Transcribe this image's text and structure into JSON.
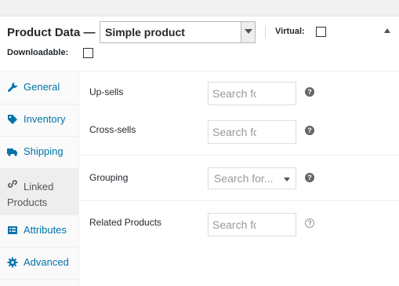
{
  "header": {
    "title": "Product Data",
    "dash": "—",
    "product_type": "Simple product",
    "virtual_label": "Virtual:",
    "downloadable_label": "Downloadable:"
  },
  "tabs": [
    {
      "label": "General",
      "icon": "wrench-icon"
    },
    {
      "label": "Inventory",
      "icon": "tag-icon"
    },
    {
      "label": "Shipping",
      "icon": "truck-icon"
    },
    {
      "label": "Linked Products",
      "icon": "link-icon"
    },
    {
      "label": "Attributes",
      "icon": "list-icon"
    },
    {
      "label": "Advanced",
      "icon": "gear-icon"
    }
  ],
  "panel": {
    "upsells": {
      "label": "Up-sells",
      "placeholder": "Search fo"
    },
    "crosssells": {
      "label": "Cross-sells",
      "placeholder": "Search fo"
    },
    "grouping": {
      "label": "Grouping",
      "placeholder": "Search for..."
    },
    "related": {
      "label": "Related Products",
      "placeholder": "Search fo"
    }
  },
  "colors": {
    "link": "#0073aa",
    "active_tab_bg": "#eeeeee"
  }
}
